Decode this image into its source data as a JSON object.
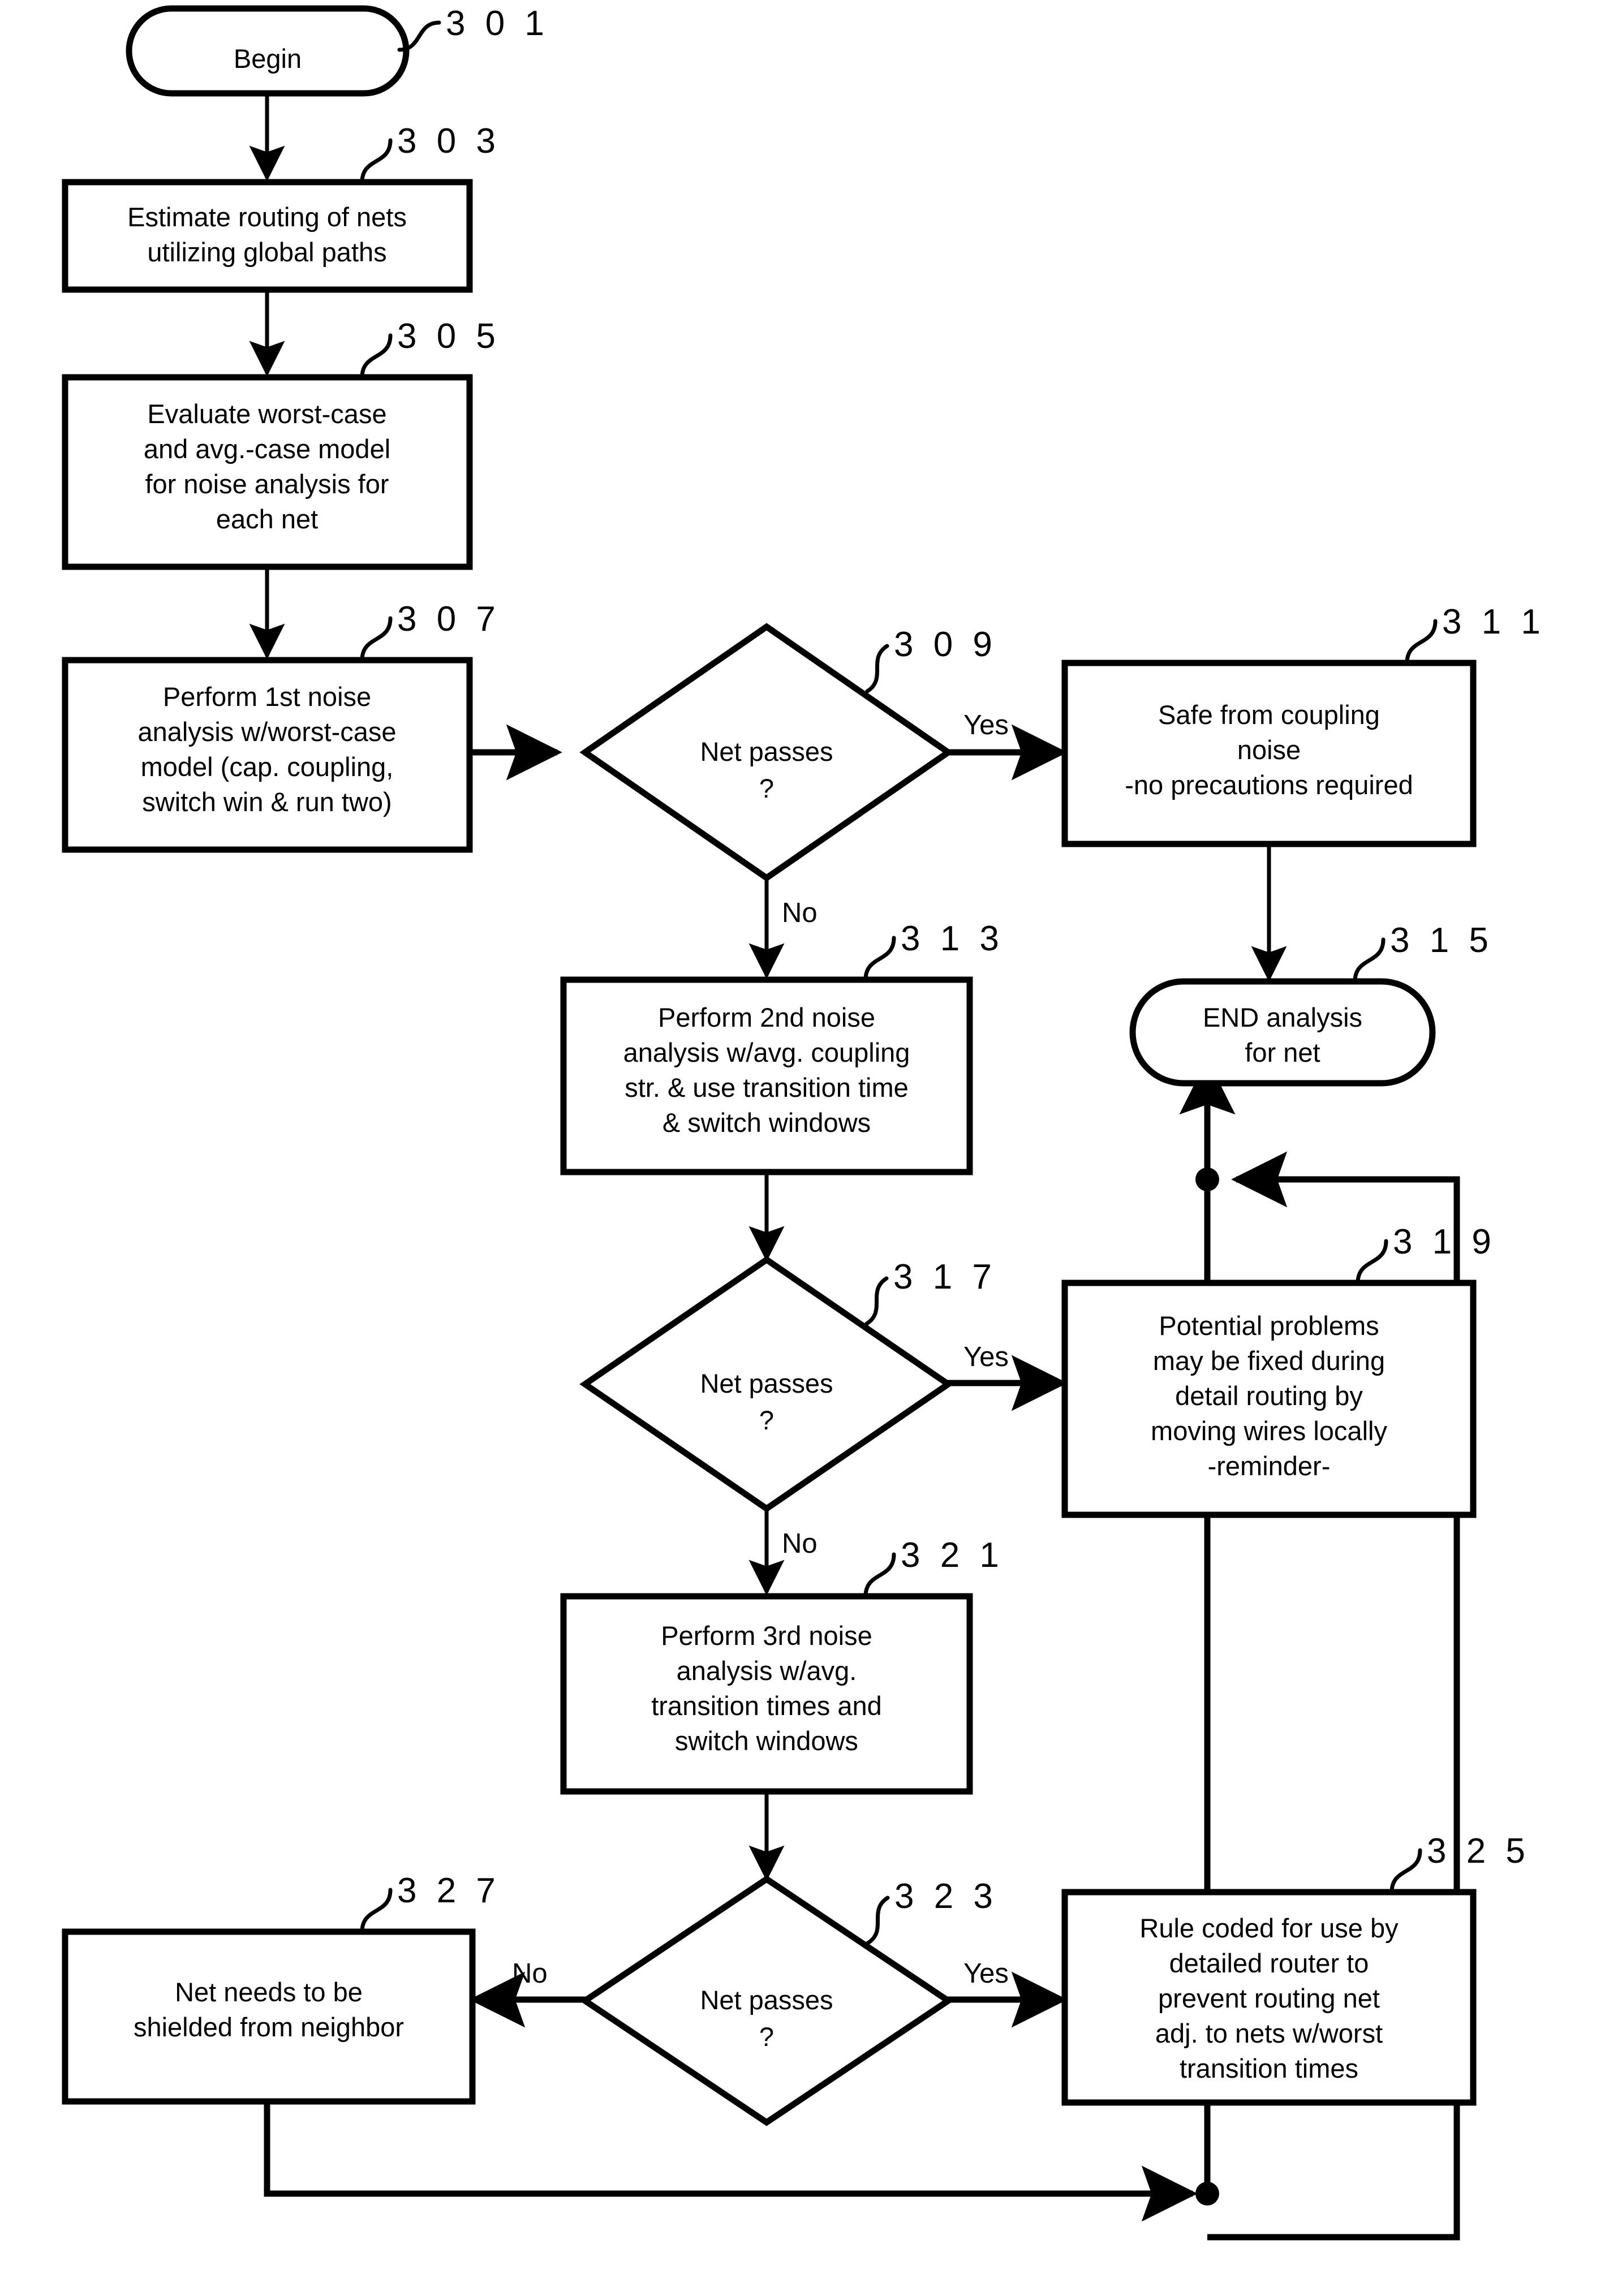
{
  "figure": {
    "title": "Noise analysis flow for nets",
    "background": "#ffffff",
    "ink": "#000000"
  },
  "nodes": [
    {
      "ref": "3 0 1",
      "type": "terminator",
      "name": "begin",
      "lines": [
        "Begin"
      ]
    },
    {
      "ref": "3 0 3",
      "type": "process",
      "name": "estimate-routing",
      "lines": [
        "Estimate routing of nets",
        "utilizing global paths"
      ]
    },
    {
      "ref": "3 0 5",
      "type": "process",
      "name": "evaluate-models",
      "lines": [
        "Evaluate worst-case",
        "and avg.-case model",
        "for noise analysis for",
        "each net"
      ]
    },
    {
      "ref": "3 0 7",
      "type": "process",
      "name": "first-noise-analysis",
      "lines": [
        "Perform 1st noise",
        "analysis w/worst-case",
        "model (cap. coupling,",
        "switch win & run two)"
      ]
    },
    {
      "ref": "3 0 9",
      "type": "decision",
      "name": "net-passes-1",
      "lines": [
        "Net passes",
        "?"
      ]
    },
    {
      "ref": "3 1 1",
      "type": "process",
      "name": "safe-from-coupling",
      "lines": [
        "Safe from coupling",
        "noise",
        "-no precautions required"
      ]
    },
    {
      "ref": "3 1 3",
      "type": "process",
      "name": "second-noise-analysis",
      "lines": [
        "Perform 2nd noise",
        "analysis w/avg. coupling",
        "str. & use transition time",
        "& switch windows"
      ]
    },
    {
      "ref": "3 1 5",
      "type": "terminator",
      "name": "end-analysis",
      "lines": [
        "END analysis",
        "for net"
      ]
    },
    {
      "ref": "3 1 7",
      "type": "decision",
      "name": "net-passes-2",
      "lines": [
        "Net passes",
        "?"
      ]
    },
    {
      "ref": "3 1 9",
      "type": "process",
      "name": "potential-problems",
      "lines": [
        "Potential problems",
        "may be fixed during",
        "detail routing by",
        "moving wires locally",
        "-reminder-"
      ]
    },
    {
      "ref": "3 2 1",
      "type": "process",
      "name": "third-noise-analysis",
      "lines": [
        "Perform 3rd noise",
        "analysis w/avg.",
        "transition times and",
        "switch windows"
      ]
    },
    {
      "ref": "3 2 3",
      "type": "decision",
      "name": "net-passes-3",
      "lines": [
        "Net passes",
        "?"
      ]
    },
    {
      "ref": "3 2 5",
      "type": "process",
      "name": "rule-coded",
      "lines": [
        "Rule coded for use by",
        "detailed router to",
        "prevent routing net",
        "adj. to nets w/worst",
        "transition times"
      ]
    },
    {
      "ref": "3 2 7",
      "type": "process",
      "name": "net-shielded",
      "lines": [
        "Net needs to be",
        "shielded from neighbor"
      ]
    }
  ],
  "edge_labels": {
    "d309_yes": "Yes",
    "d309_no": "No",
    "d317_yes": "Yes",
    "d317_no": "No",
    "d323_yes": "Yes",
    "d323_no": "No"
  }
}
